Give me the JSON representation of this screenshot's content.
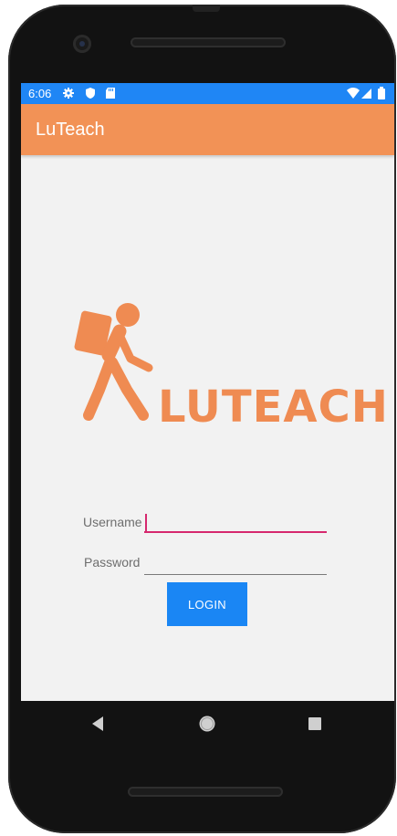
{
  "status_bar": {
    "time": "6:06",
    "icons": [
      "settings-icon",
      "shield-icon",
      "sd-card-icon",
      "wifi-icon",
      "signal-icon",
      "battery-icon"
    ]
  },
  "app_bar": {
    "title": "LuTeach"
  },
  "logo": {
    "text": "LUTEACH"
  },
  "login_form": {
    "username_label": "Username",
    "username_value": "",
    "password_label": "Password",
    "password_value": "",
    "login_button": "LOGIN"
  },
  "nav_bar": {
    "icons": [
      "back-icon",
      "home-icon",
      "recents-icon"
    ]
  },
  "colors": {
    "status_bar": "#1f86f5",
    "app_bar": "#f29256",
    "accent": "#d6286e",
    "button": "#1a86f4",
    "logo": "#ef8b52"
  }
}
